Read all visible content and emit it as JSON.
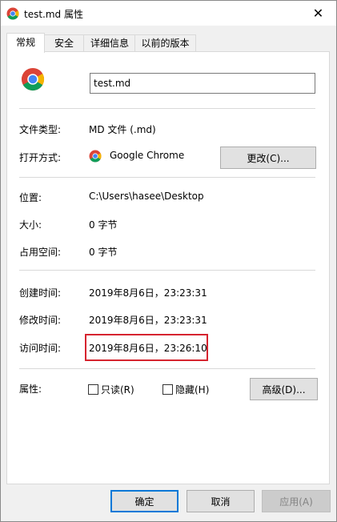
{
  "window": {
    "title": "test.md 属性",
    "close_glyph": "✕"
  },
  "tabs": [
    {
      "label": "常规",
      "active": true
    },
    {
      "label": "安全",
      "active": false
    },
    {
      "label": "详细信息",
      "active": false
    },
    {
      "label": "以前的版本",
      "active": false
    }
  ],
  "general": {
    "filename": "test.md",
    "file_icon": "chrome-icon",
    "file_type_label": "文件类型:",
    "file_type_value": "MD 文件 (.md)",
    "opens_with_label": "打开方式:",
    "opens_with_value": "Google Chrome",
    "change_button": "更改(C)...",
    "location_label": "位置:",
    "location_value": "C:\\Users\\hasee\\Desktop",
    "size_label": "大小:",
    "size_value": "0 字节",
    "size_on_disk_label": "占用空间:",
    "size_on_disk_value": "0 字节",
    "created_label": "创建时间:",
    "created_value": "2019年8月6日，23:23:31",
    "modified_label": "修改时间:",
    "modified_value": "2019年8月6日，23:23:31",
    "accessed_label": "访问时间:",
    "accessed_value": "2019年8月6日，23:26:10",
    "attributes_label": "属性:",
    "readonly_label": "只读(R)",
    "readonly_checked": false,
    "hidden_label": "隐藏(H)",
    "hidden_checked": false,
    "advanced_button": "高级(D)..."
  },
  "footer": {
    "ok": "确定",
    "cancel": "取消",
    "apply": "应用(A)"
  },
  "colors": {
    "highlight": "#d6242f",
    "focus": "#0078d7"
  }
}
